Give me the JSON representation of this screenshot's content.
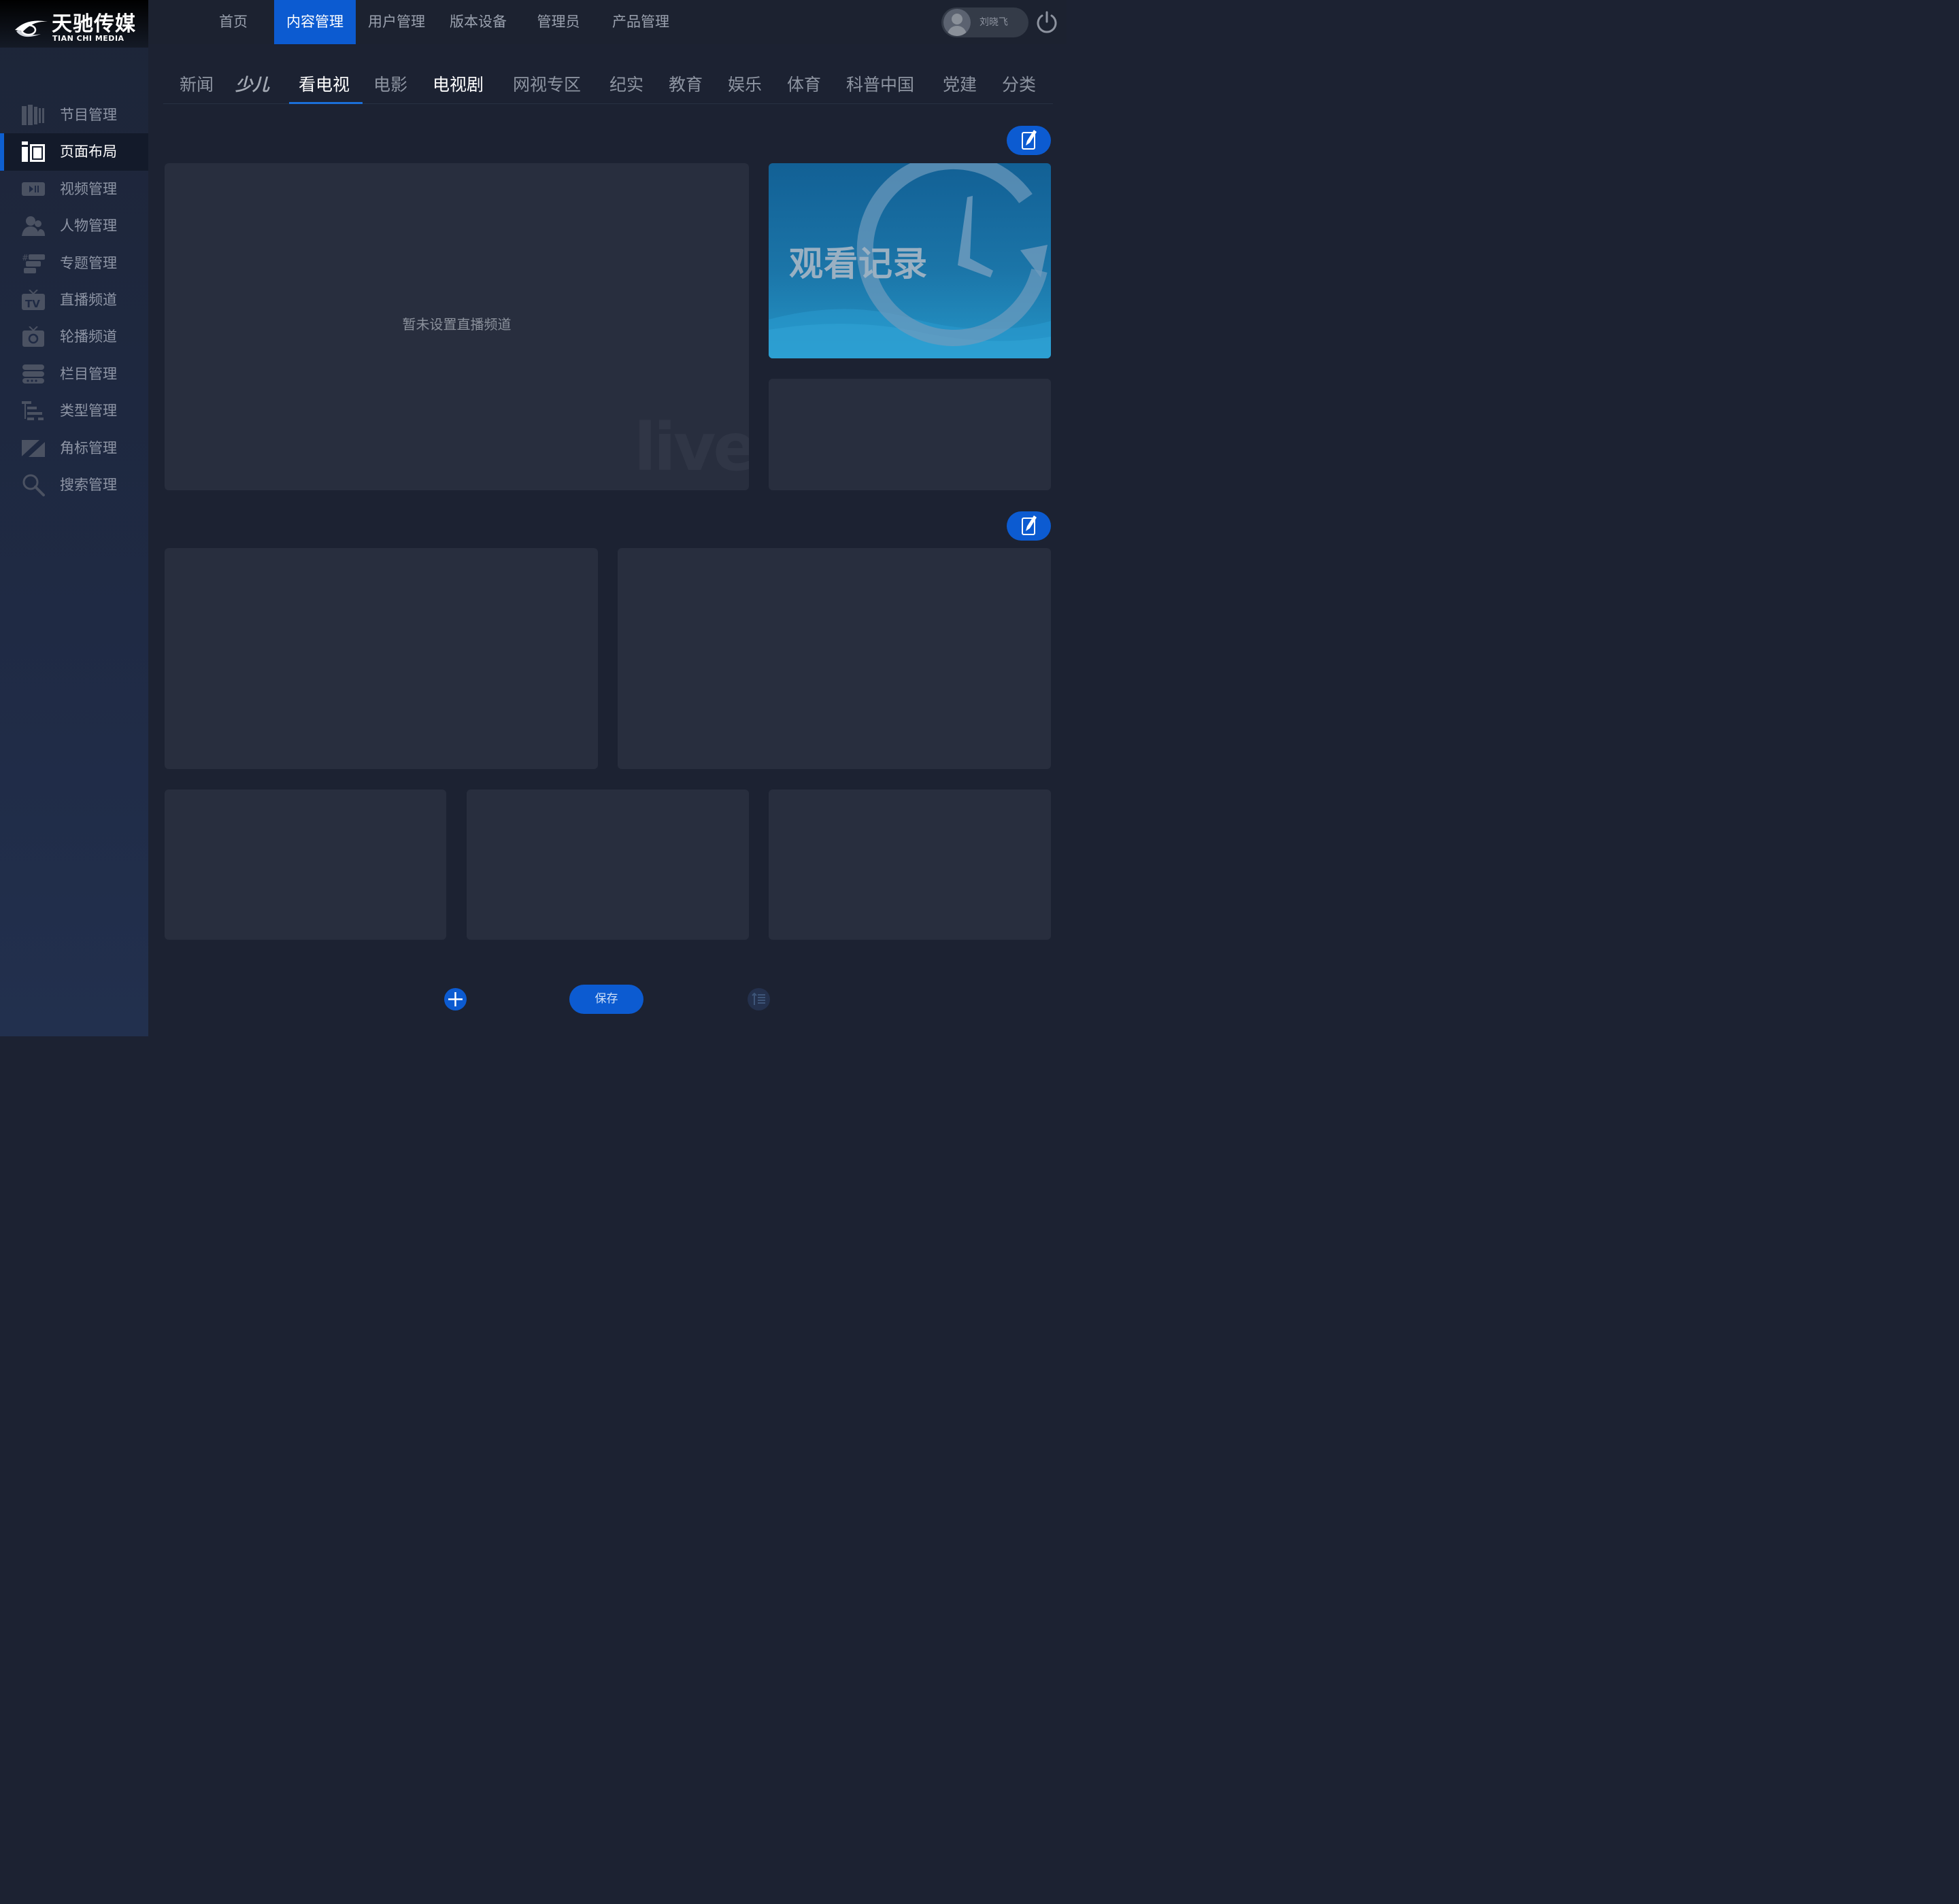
{
  "brand": {
    "name_cn": "天驰传媒",
    "name_en": "TIAN CHI MEDIA"
  },
  "top_nav": [
    {
      "label": "首页"
    },
    {
      "label": "内容管理",
      "active": true
    },
    {
      "label": "用户管理"
    },
    {
      "label": "版本设备"
    },
    {
      "label": "管理员"
    },
    {
      "label": "产品管理"
    }
  ],
  "user": {
    "name": "刘晓飞"
  },
  "sidebar": {
    "items": [
      {
        "label": "节目管理",
        "icon": "books-icon"
      },
      {
        "label": "页面布局",
        "icon": "layout-icon",
        "active": true
      },
      {
        "label": "视频管理",
        "icon": "video-icon"
      },
      {
        "label": "人物管理",
        "icon": "people-icon"
      },
      {
        "label": "专题管理",
        "icon": "topic-icon"
      },
      {
        "label": "直播频道",
        "icon": "tv-icon"
      },
      {
        "label": "轮播频道",
        "icon": "carousel-icon"
      },
      {
        "label": "栏目管理",
        "icon": "columns-icon"
      },
      {
        "label": "类型管理",
        "icon": "types-icon"
      },
      {
        "label": "角标管理",
        "icon": "corner-badge-icon"
      },
      {
        "label": "搜索管理",
        "icon": "search-icon"
      }
    ]
  },
  "tabs": [
    {
      "label": "新闻"
    },
    {
      "label": "少儿"
    },
    {
      "label": "看电视",
      "active": true
    },
    {
      "label": "电影"
    },
    {
      "label": "电视剧"
    },
    {
      "label": "网视专区"
    },
    {
      "label": "纪实"
    },
    {
      "label": "教育"
    },
    {
      "label": "娱乐"
    },
    {
      "label": "体育"
    },
    {
      "label": "科普中国"
    },
    {
      "label": "党建"
    },
    {
      "label": "分类"
    }
  ],
  "layout": {
    "live_placeholder": "暂未设置直播频道",
    "live_watermark": "live",
    "history_label": "观看记录"
  },
  "actions": {
    "save_label": "保存"
  },
  "colors": {
    "accent": "#0c5bd1",
    "background": "#1c2232",
    "panel": "#282e3e",
    "sidebar": "#1f2a44"
  }
}
